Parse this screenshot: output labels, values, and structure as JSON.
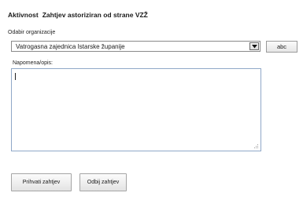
{
  "header": {
    "activity_label": "Aktivnost",
    "activity_value": "Zahtjev astoriziran od strane VZŽ"
  },
  "organization": {
    "label": "Odabir organizacije",
    "selected": "Vatrogasna zajednica Istarske županije",
    "side_button": "abc"
  },
  "note": {
    "label": "Napomena/opis:",
    "value": ""
  },
  "actions": {
    "accept_label": "Prihvati zahtjev",
    "reject_label": "Odbij zahtjev"
  },
  "icons": {
    "dropdown": "chevron-down-icon",
    "resize": "resize-grip-icon"
  }
}
